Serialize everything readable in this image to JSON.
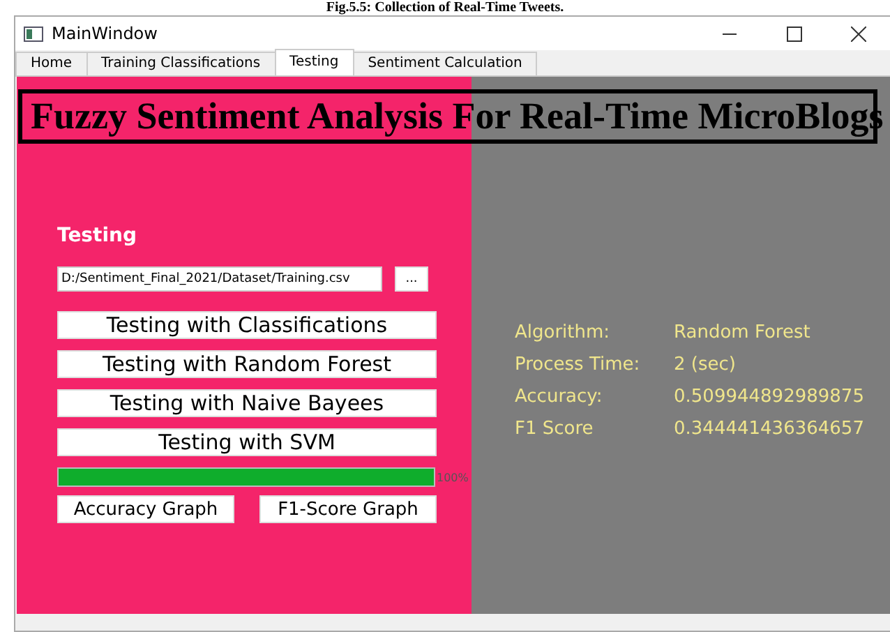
{
  "caption": "Fig.5.5: Collection of Real-Time Tweets.",
  "window": {
    "title": "MainWindow"
  },
  "tabs": [
    {
      "label": "Home",
      "selected": false
    },
    {
      "label": "Training Classifications",
      "selected": false
    },
    {
      "label": "Testing",
      "selected": true
    },
    {
      "label": "Sentiment Calculation",
      "selected": false
    }
  ],
  "banner": "Fuzzy Sentiment Analysis For Real-Time MicroBlogs",
  "testing": {
    "heading": "Testing",
    "file_path": "D:/Sentiment_Final_2021/Dataset/Training.csv",
    "browse_button": "...",
    "actions": [
      "Testing with Classifications",
      "Testing with Random Forest",
      "Testing with Naive Bayees",
      "Testing with SVM"
    ],
    "progress": {
      "level": 1,
      "reading": "100%"
    },
    "graph_buttons": [
      "Accuracy Graph",
      "F1-Score Graph"
    ]
  },
  "results": [
    {
      "label": "Algorithm:",
      "value": "Random Forest"
    },
    {
      "label": "Process Time:",
      "value": "2 (sec)"
    },
    {
      "label": "Accuracy:",
      "value": "0.509944892989875"
    },
    {
      "label": "F1 Score",
      "value": "0.344441436364657"
    }
  ]
}
